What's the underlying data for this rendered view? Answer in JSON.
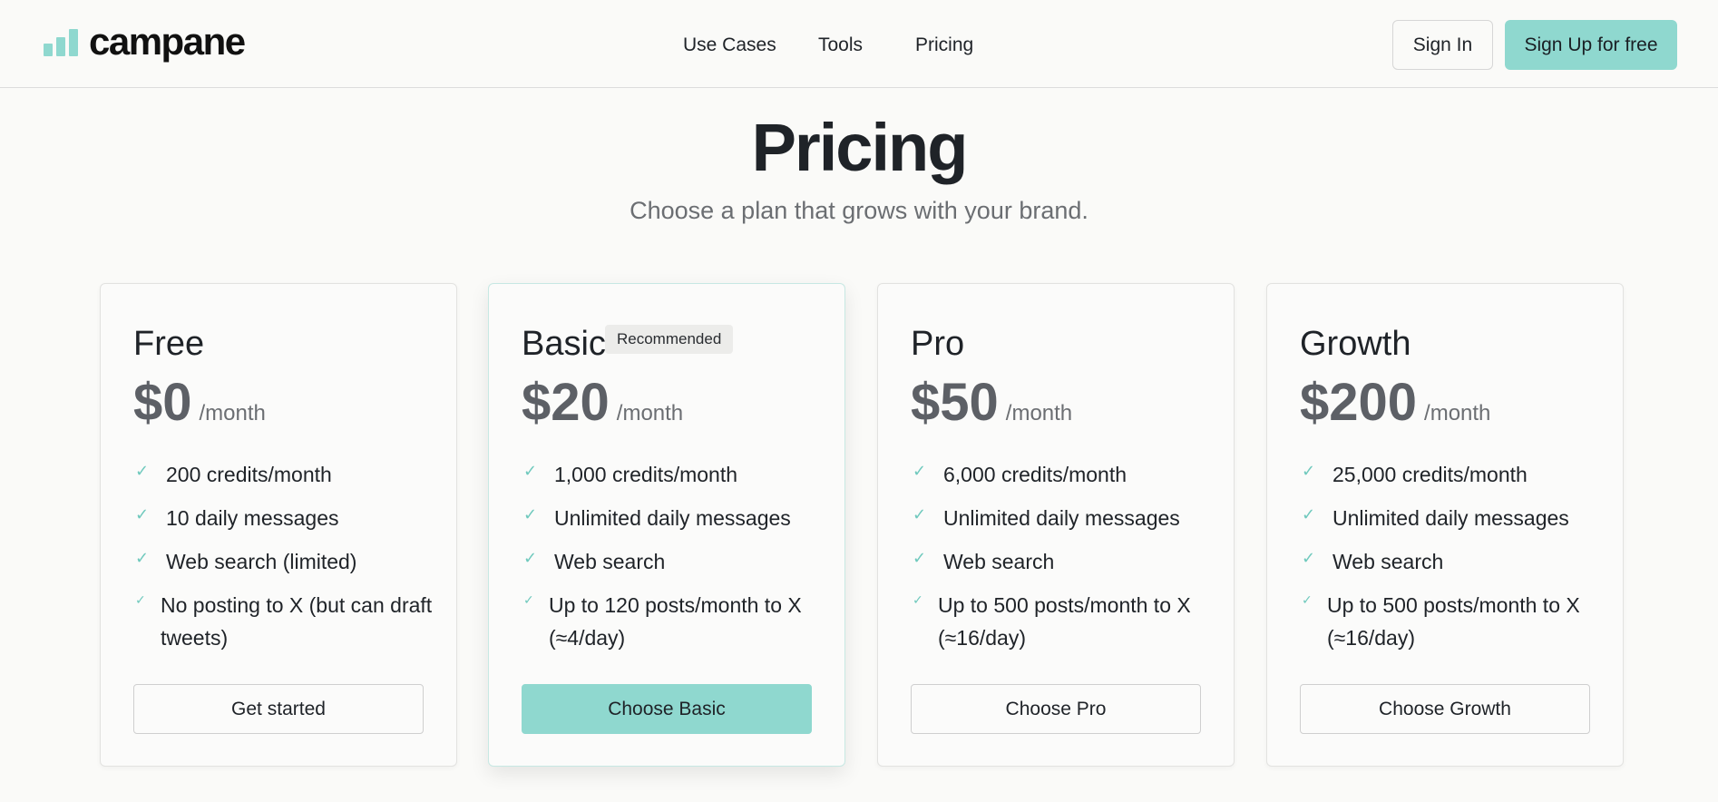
{
  "header": {
    "brand": "campane",
    "nav": [
      "Use Cases",
      "Tools",
      "Pricing"
    ],
    "sign_in": "Sign In",
    "sign_up": "Sign Up for free"
  },
  "hero": {
    "title": "Pricing",
    "subtitle": "Choose a plan that grows with your brand."
  },
  "colors": {
    "accent": "#8fd8cf",
    "check": "#6fc9bd",
    "price": "#5d6066",
    "text": "#1f2328",
    "muted": "#6b6e72"
  },
  "icons": {
    "feature_check": "check-icon",
    "logo": "bar-chart-logo-icon"
  },
  "plans": [
    {
      "name": "Free",
      "badge": "",
      "price": "$0",
      "period": "/month",
      "features": [
        "200 credits/month",
        "10 daily messages",
        "Web search (limited)",
        "No posting to X (but can draft tweets)"
      ],
      "button": "Get started",
      "featured": false
    },
    {
      "name": "Basic",
      "badge": "Recommended",
      "price": "$20",
      "period": "/month",
      "features": [
        "1,000 credits/month",
        "Unlimited daily messages",
        "Web search",
        "Up to 120 posts/month to X (≈4/day)"
      ],
      "button": "Choose Basic",
      "featured": true
    },
    {
      "name": "Pro",
      "badge": "",
      "price": "$50",
      "period": "/month",
      "features": [
        "6,000 credits/month",
        "Unlimited daily messages",
        "Web search",
        "Up to 500 posts/month to X (≈16/day)"
      ],
      "button": "Choose Pro",
      "featured": false
    },
    {
      "name": "Growth",
      "badge": "",
      "price": "$200",
      "period": "/month",
      "features": [
        "25,000 credits/month",
        "Unlimited daily messages",
        "Web search",
        "Up to 500 posts/month to X (≈16/day)"
      ],
      "button": "Choose Growth",
      "featured": false
    }
  ]
}
